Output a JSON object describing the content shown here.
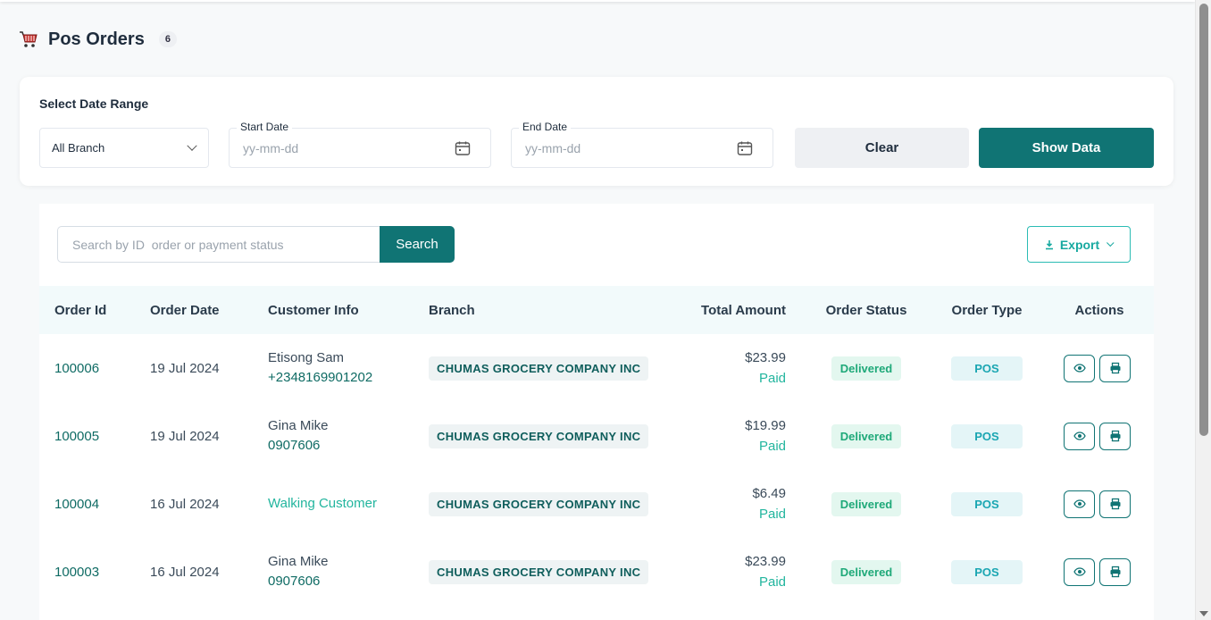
{
  "header": {
    "title": "Pos Orders",
    "count": "6",
    "icon": "shopping-cart-icon"
  },
  "filters": {
    "section_label": "Select Date Range",
    "branch_selected": "All Branch",
    "start_date_label": "Start Date",
    "start_date_placeholder": "yy-mm-dd",
    "end_date_label": "End Date",
    "end_date_placeholder": "yy-mm-dd",
    "clear_label": "Clear",
    "show_label": "Show Data"
  },
  "toolbar": {
    "search_placeholder": "Search by ID  order or payment status",
    "search_button": "Search",
    "export_label": "Export"
  },
  "table": {
    "columns": [
      "Order Id",
      "Order Date",
      "Customer Info",
      "Branch",
      "Total Amount",
      "Order Status",
      "Order Type",
      "Actions"
    ],
    "rows": [
      {
        "id": "100006",
        "date": "19 Jul 2024",
        "customer_name": "Etisong Sam",
        "customer_phone": "+2348169901202",
        "branch": "CHUMAS GROCERY COMPANY INC",
        "amount": "$23.99",
        "payment": "Paid",
        "status": "Delivered",
        "type": "POS"
      },
      {
        "id": "100005",
        "date": "19 Jul 2024",
        "customer_name": "Gina Mike",
        "customer_phone": "0907606",
        "branch": "CHUMAS GROCERY COMPANY INC",
        "amount": "$19.99",
        "payment": "Paid",
        "status": "Delivered",
        "type": "POS"
      },
      {
        "id": "100004",
        "date": "16 Jul 2024",
        "customer_name": "Walking Customer",
        "customer_phone": "",
        "branch": "CHUMAS GROCERY COMPANY INC",
        "amount": "$6.49",
        "payment": "Paid",
        "status": "Delivered",
        "type": "POS"
      },
      {
        "id": "100003",
        "date": "16 Jul 2024",
        "customer_name": "Gina Mike",
        "customer_phone": "0907606",
        "branch": "CHUMAS GROCERY COMPANY INC",
        "amount": "$23.99",
        "payment": "Paid",
        "status": "Delivered",
        "type": "POS"
      }
    ]
  },
  "colors": {
    "primary": "#107474",
    "accent": "#22b59e",
    "status_bg": "#e3f7ef"
  }
}
